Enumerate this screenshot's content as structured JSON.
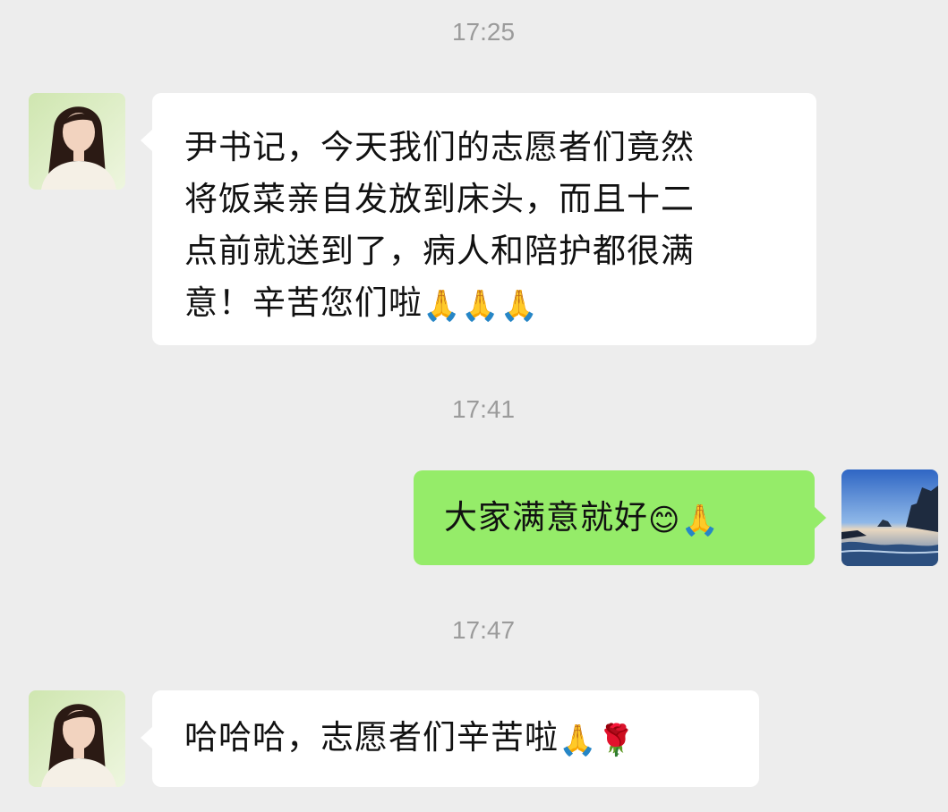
{
  "chat": {
    "messages": [
      {
        "timestamp": "17:25",
        "sender": "incoming",
        "text": "尹书记，今天我们的志愿者们竟然将饭菜亲自发放到床头，而且十二点前就送到了，病人和陪护都很满意！辛苦您们啦",
        "lines": [
          "尹书记，今天我们的志愿者们竟然",
          "将饭菜亲自发放到床头，而且十二",
          "点前就送到了，病人和陪护都很满",
          "意！辛苦您们啦"
        ],
        "emoji": [
          "🙏",
          "🙏",
          "🙏"
        ],
        "emoji_icons": [
          "folded-hands-icon",
          "folded-hands-icon",
          "folded-hands-icon"
        ]
      },
      {
        "timestamp": "17:41",
        "sender": "outgoing",
        "text": "大家满意就好",
        "emoji": [
          "😊",
          "🙏"
        ],
        "emoji_icons": [
          "smiling-face-icon",
          "folded-hands-icon"
        ]
      },
      {
        "timestamp": "17:47",
        "sender": "incoming",
        "text": "哈哈哈，志愿者们辛苦啦",
        "emoji": [
          "🙏",
          "🌹"
        ],
        "emoji_icons": [
          "folded-hands-icon",
          "rose-icon"
        ]
      }
    ]
  },
  "colors": {
    "background": "#ededed",
    "incoming_bubble": "#ffffff",
    "outgoing_bubble": "#95ec69",
    "timestamp_text": "#9b9b9b",
    "message_text": "#111111"
  },
  "avatars": {
    "contact_icon": "contact-avatar-woman",
    "self_icon": "self-avatar-seascape"
  }
}
